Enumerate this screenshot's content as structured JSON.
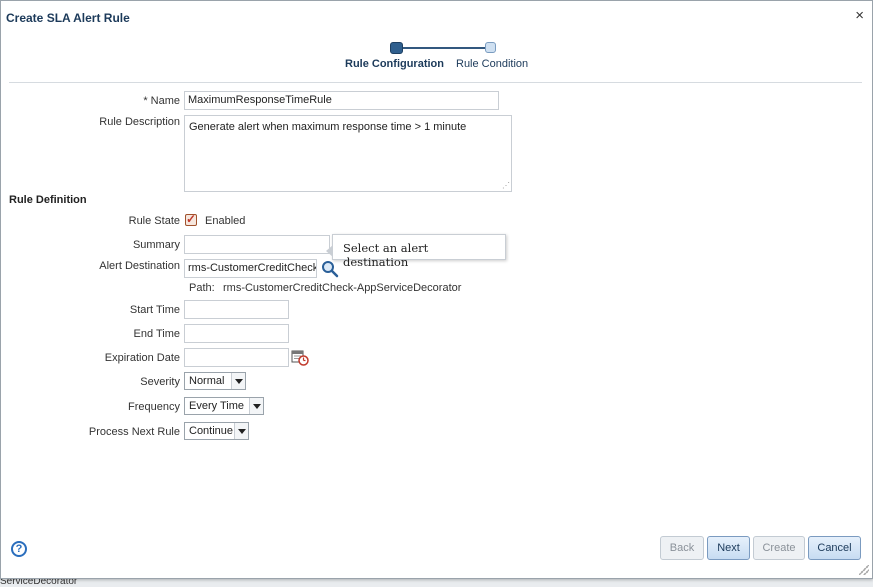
{
  "dialog": {
    "title": "Create SLA Alert Rule",
    "close_symbol": "×"
  },
  "train": {
    "steps": [
      "Rule Configuration",
      "Rule Condition"
    ],
    "active_step": 0
  },
  "form": {
    "name": {
      "label": "* Name",
      "value": "MaximumResponseTimeRule"
    },
    "description": {
      "label": "Rule Description",
      "value": "Generate alert when maximum response time > 1 minute"
    },
    "section_title": "Rule Definition",
    "rule_state": {
      "label": "Rule State",
      "checked": true,
      "option_label": "Enabled"
    },
    "summary": {
      "label": "Summary",
      "value": ""
    },
    "alert_destination": {
      "label": "Alert Destination",
      "value": "rms-CustomerCreditCheck",
      "tooltip": "Select an alert destination",
      "path_label": "Path:",
      "path_value": "rms-CustomerCreditCheck-AppServiceDecorator"
    },
    "start_time": {
      "label": "Start Time",
      "value": ""
    },
    "end_time": {
      "label": "End Time",
      "value": ""
    },
    "expiration_date": {
      "label": "Expiration Date",
      "value": ""
    },
    "severity": {
      "label": "Severity",
      "value": "Normal"
    },
    "frequency": {
      "label": "Frequency",
      "value": "Every Time"
    },
    "process_next_rule": {
      "label": "Process Next Rule",
      "value": "Continue"
    }
  },
  "footer": {
    "help_symbol": "?",
    "buttons": {
      "back": "Back",
      "next": "Next",
      "create": "Create",
      "cancel": "Cancel"
    },
    "disabled": [
      "Back",
      "Create"
    ]
  },
  "background": {
    "text": "ServiceDecorator"
  },
  "colors": {
    "accent": "#2f5f8e",
    "title": "#1c3a5a",
    "checkbox": "#c0392b"
  },
  "icons": [
    "close-icon",
    "search-icon",
    "calendar-icon",
    "help-icon",
    "chevron-down-icon"
  ]
}
